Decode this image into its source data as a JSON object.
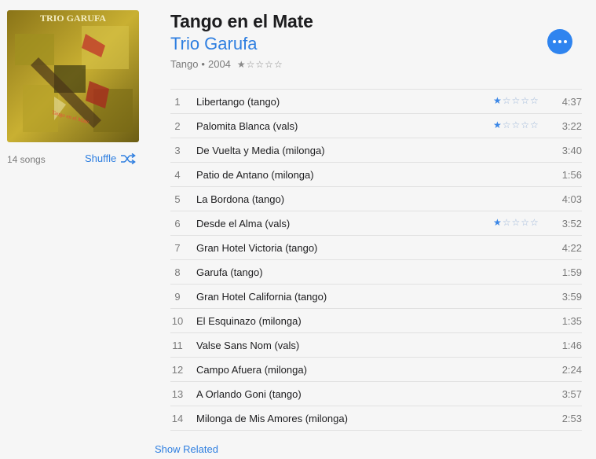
{
  "album": {
    "title": "Tango en el Mate",
    "artist": "Trio Garufa",
    "genre": "Tango",
    "separator": "•",
    "year": "2004",
    "rating_stars": "★☆☆☆☆",
    "artwork_text_top": "TRIO GARUFA",
    "artwork_text_small": "Tango en el Mate"
  },
  "sidebar": {
    "song_count": "14 songs",
    "shuffle_label": "Shuffle"
  },
  "tracks": [
    {
      "num": "1",
      "name": "Libertango (tango)",
      "rating": "★",
      "rating_empty": "☆☆☆☆",
      "duration": "4:37"
    },
    {
      "num": "2",
      "name": "Palomita Blanca (vals)",
      "rating": "★",
      "rating_empty": "☆☆☆☆",
      "duration": "3:22"
    },
    {
      "num": "3",
      "name": "De Vuelta y Media (milonga)",
      "rating": "",
      "rating_empty": "",
      "duration": "3:40"
    },
    {
      "num": "4",
      "name": "Patio de Antano (milonga)",
      "rating": "",
      "rating_empty": "",
      "duration": "1:56"
    },
    {
      "num": "5",
      "name": "La Bordona (tango)",
      "rating": "",
      "rating_empty": "",
      "duration": "4:03"
    },
    {
      "num": "6",
      "name": "Desde el Alma (vals)",
      "rating": "★",
      "rating_empty": "☆☆☆☆",
      "duration": "3:52"
    },
    {
      "num": "7",
      "name": "Gran Hotel Victoria (tango)",
      "rating": "",
      "rating_empty": "",
      "duration": "4:22"
    },
    {
      "num": "8",
      "name": "Garufa (tango)",
      "rating": "",
      "rating_empty": "",
      "duration": "1:59"
    },
    {
      "num": "9",
      "name": "Gran Hotel California (tango)",
      "rating": "",
      "rating_empty": "",
      "duration": "3:59"
    },
    {
      "num": "10",
      "name": "El Esquinazo (milonga)",
      "rating": "",
      "rating_empty": "",
      "duration": "1:35"
    },
    {
      "num": "11",
      "name": "Valse Sans Nom (vals)",
      "rating": "",
      "rating_empty": "",
      "duration": "1:46"
    },
    {
      "num": "12",
      "name": "Campo Afuera (milonga)",
      "rating": "",
      "rating_empty": "",
      "duration": "2:24"
    },
    {
      "num": "13",
      "name": "A Orlando Goni (tango)",
      "rating": "",
      "rating_empty": "",
      "duration": "3:57"
    },
    {
      "num": "14",
      "name": "Milonga de Mis Amores (milonga)",
      "rating": "",
      "rating_empty": "",
      "duration": "2:53"
    }
  ],
  "footer": {
    "show_related_label": "Show Related"
  },
  "colors": {
    "accent": "#2f7fe0",
    "more_button": "#2f84ef",
    "background": "#f6f6f6"
  },
  "icons": {
    "shuffle": "shuffle-icon",
    "more": "more-icon"
  }
}
